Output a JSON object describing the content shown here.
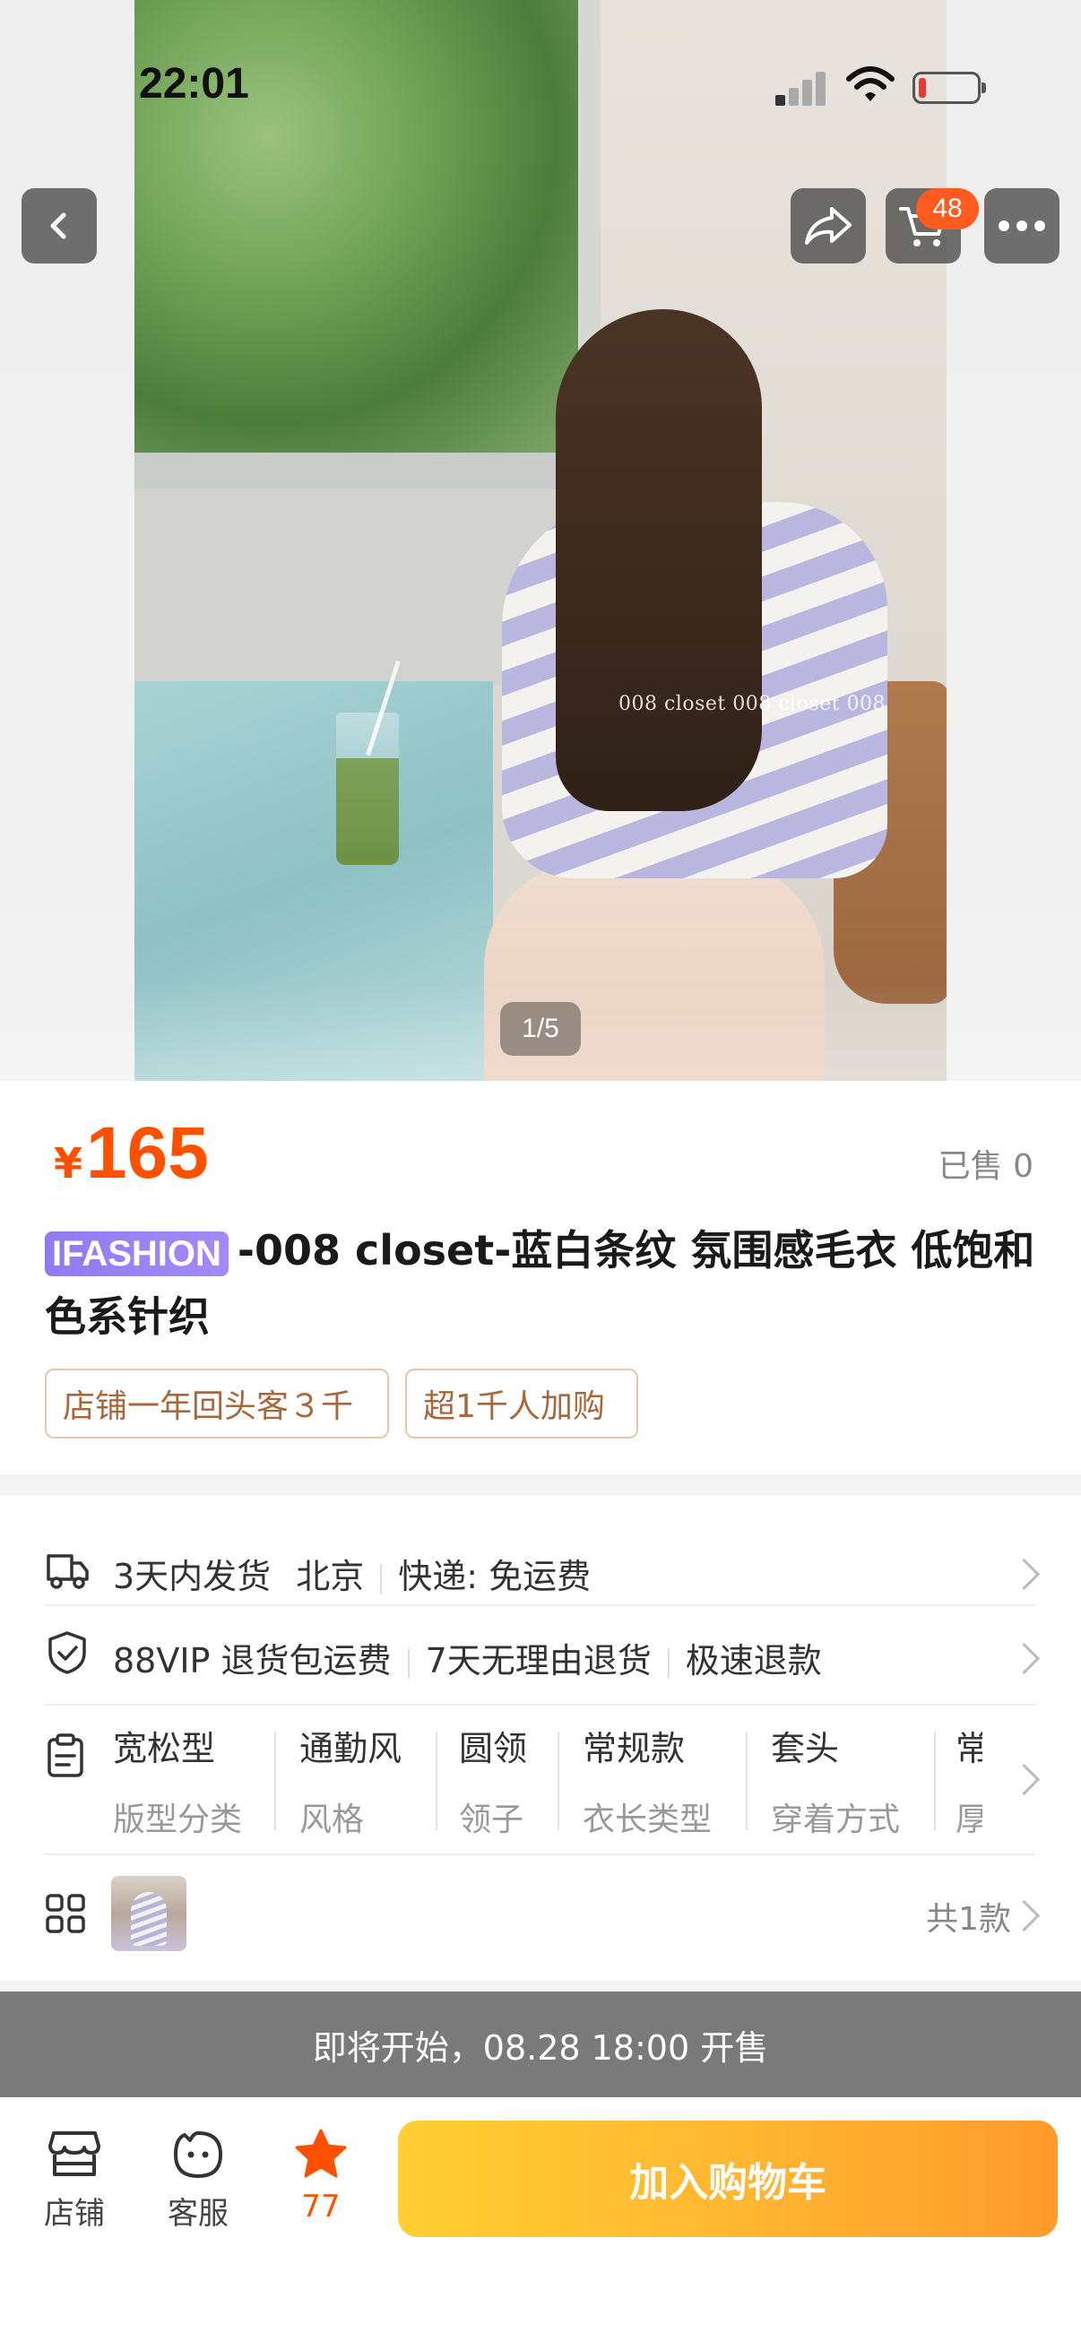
{
  "status_bar": {
    "time": "22:01"
  },
  "nav": {
    "cart_count": "48"
  },
  "hero": {
    "watermark": "008 closet 008 closet 008",
    "page_indicator": "1/5"
  },
  "product": {
    "price_symbol": "¥",
    "price": "165",
    "sold": "已售 0",
    "brand_tag": "IFASHION",
    "title": "-008 closet-蓝白条纹 氛围感毛衣 低饱和色系针织",
    "tags": [
      "店铺一年回头客３千",
      "超1千人加购"
    ]
  },
  "shipping": {
    "time": "3天内发货",
    "origin": "北京",
    "express": "快递: 免运费"
  },
  "guarantees": [
    "88VIP 退货包运费",
    "7天无理由退货",
    "极速退款"
  ],
  "attributes": [
    {
      "value": "宽松型",
      "key": "版型分类"
    },
    {
      "value": "通勤风",
      "key": "风格"
    },
    {
      "value": "圆领",
      "key": "领子"
    },
    {
      "value": "常规款",
      "key": "衣长类型"
    },
    {
      "value": "套头",
      "key": "穿着方式"
    },
    {
      "value": "常",
      "key": "厚"
    }
  ],
  "variants": {
    "count_label": "共1款"
  },
  "presale_banner": "即将开始，08.28 18:00 开售",
  "bottom_bar": {
    "store_label": "店铺",
    "service_label": "客服",
    "favorite_count": "77",
    "add_to_cart_label": "加入购物车"
  },
  "colors": {
    "accent": "#ff5000",
    "brand_tag": "#9a83f3",
    "cart_button": "#ffb531",
    "presale_bg": "#7a7a7a"
  }
}
